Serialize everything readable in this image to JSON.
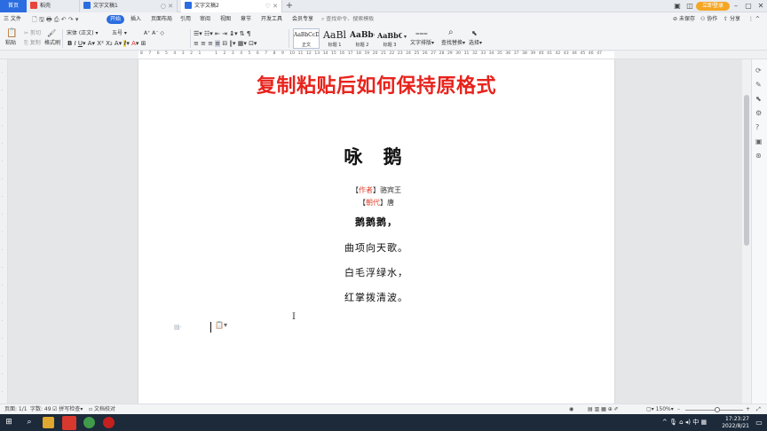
{
  "titlebar": {
    "home_tab": "首页",
    "tabs": [
      {
        "label": "稻壳",
        "icon_color": "#e8453c"
      },
      {
        "label": "文字文稿1",
        "icon_color": "#2b6de0"
      },
      {
        "label": "文字文稿2",
        "icon_color": "#2b6de0"
      }
    ],
    "login_label": "立即登录"
  },
  "menubar": {
    "file_label": "三 文件",
    "items": [
      "开始",
      "插入",
      "页面布局",
      "引用",
      "审阅",
      "视图",
      "章节",
      "开发工具",
      "会员专享"
    ],
    "search_placeholder": "查找命令、搜索模板",
    "right_items": [
      "未保存",
      "协作",
      "分享"
    ]
  },
  "ribbon": {
    "paste_label": "粘贴",
    "cut_label": "剪切",
    "copy_label": "复制",
    "format_painter_label": "格式刷",
    "font_name": "宋体 (正文)",
    "font_size": "五号",
    "styles": [
      {
        "sample": "AaBbCcDd",
        "name": "正文"
      },
      {
        "sample": "AaBl",
        "name": "标题 1"
      },
      {
        "sample": "AaBb(",
        "name": "标题 2"
      },
      {
        "sample": "AaBbC",
        "name": "标题 3"
      }
    ],
    "text_layout_label": "文字排版",
    "find_replace_label": "查找替换",
    "select_label": "选择"
  },
  "ruler": {
    "ticks": [
      "8",
      "7",
      "6",
      "5",
      "4",
      "3",
      "2",
      "1",
      "",
      "1",
      "2",
      "3",
      "4",
      "5",
      "6",
      "7",
      "8",
      "9",
      "10",
      "11",
      "12",
      "13",
      "14",
      "15",
      "16",
      "17",
      "18",
      "19",
      "20",
      "21",
      "22",
      "23",
      "24",
      "25",
      "26",
      "27",
      "28",
      "29",
      "30",
      "31",
      "32",
      "33",
      "34",
      "35",
      "36",
      "37",
      "38",
      "39",
      "40",
      "41",
      "42",
      "43",
      "44",
      "45",
      "46",
      "47"
    ]
  },
  "document": {
    "heading": "复制粘贴后如何保持原格式",
    "poem_title": "咏 鹅",
    "author_label": "作者",
    "author": "骆宾王",
    "dynasty_label": "朝代",
    "dynasty": "唐",
    "verses": [
      "鹅鹅鹅，",
      "曲项向天歌。",
      "白毛浮绿水，",
      "红掌拨清波。"
    ]
  },
  "statusbar": {
    "page": "页面: 1/1",
    "word_count": "字数: 49",
    "spell_check": "拼写检查",
    "doc_proof": "文档校对",
    "zoom": "150%",
    "zoom_fraction": 0.55
  },
  "taskbar": {
    "time": "17:23:27",
    "date": "2022/8/21"
  }
}
